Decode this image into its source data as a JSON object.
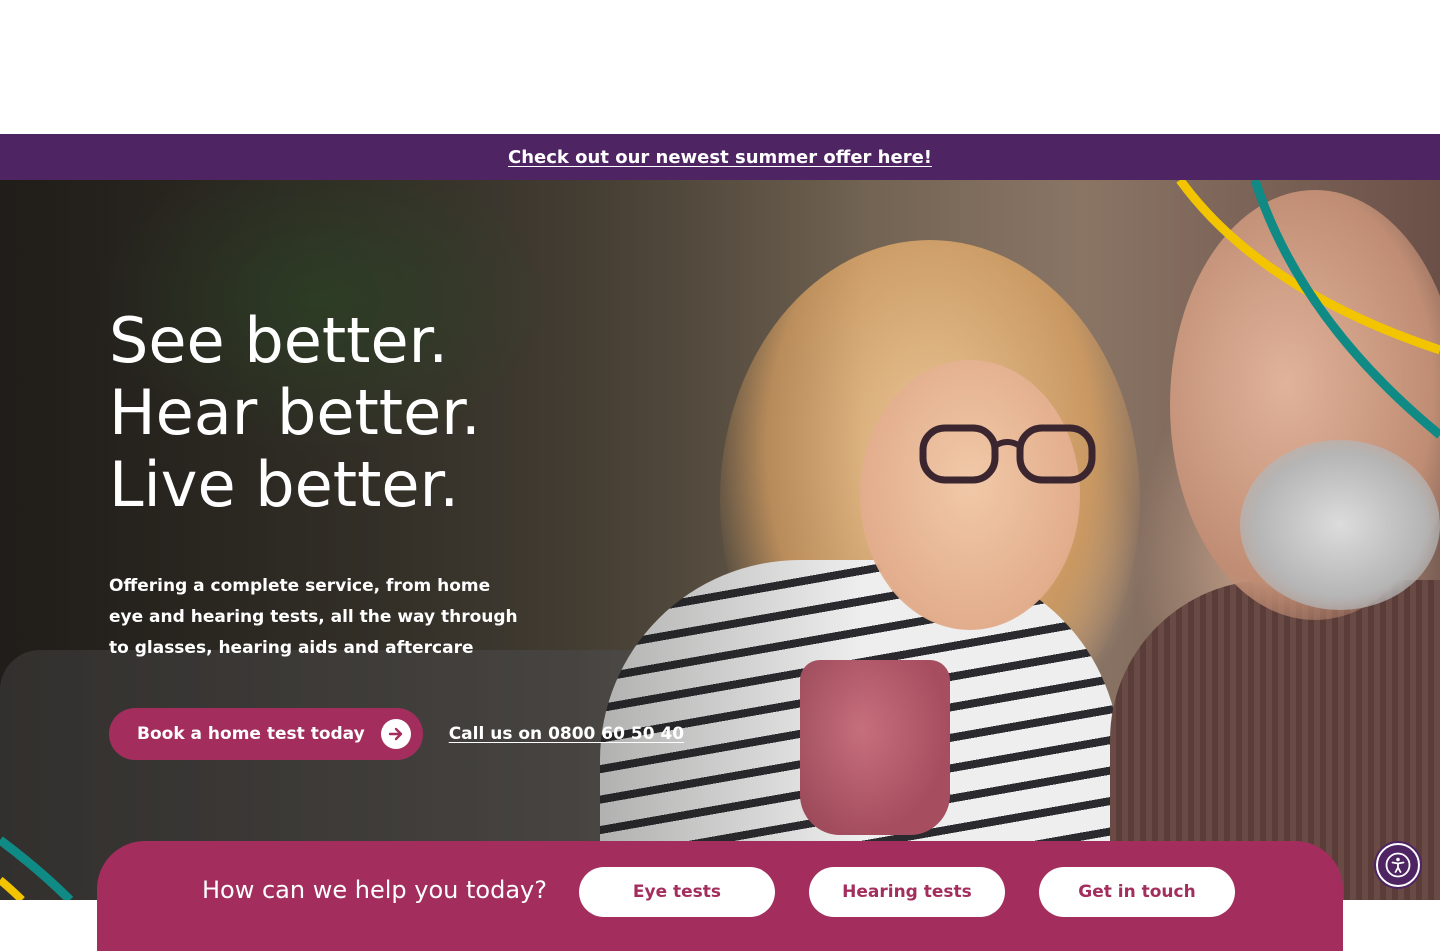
{
  "promo": {
    "text": "Check out our newest summer offer here!"
  },
  "hero": {
    "title_lines": [
      "See better.",
      "Hear better.",
      "Live better."
    ],
    "description": "Offering a complete service, from home eye and hearing tests, all the way through to glasses, hearing aids and aftercare",
    "primary_cta": {
      "label": "Book a home test today",
      "icon": "arrow-right-circle-icon"
    },
    "call_link": "Call us on 0800 60 50 40"
  },
  "help": {
    "title": "How can we help you today?",
    "buttons": [
      "Eye tests",
      "Hearing tests",
      "Get in touch"
    ]
  },
  "accessibility": {
    "icon": "accessibility-icon"
  },
  "colors": {
    "brand_purple": "#4e2463",
    "brand_raspberry": "#a32e5d",
    "accent_yellow": "#f2c500",
    "accent_teal": "#0f8a84"
  }
}
